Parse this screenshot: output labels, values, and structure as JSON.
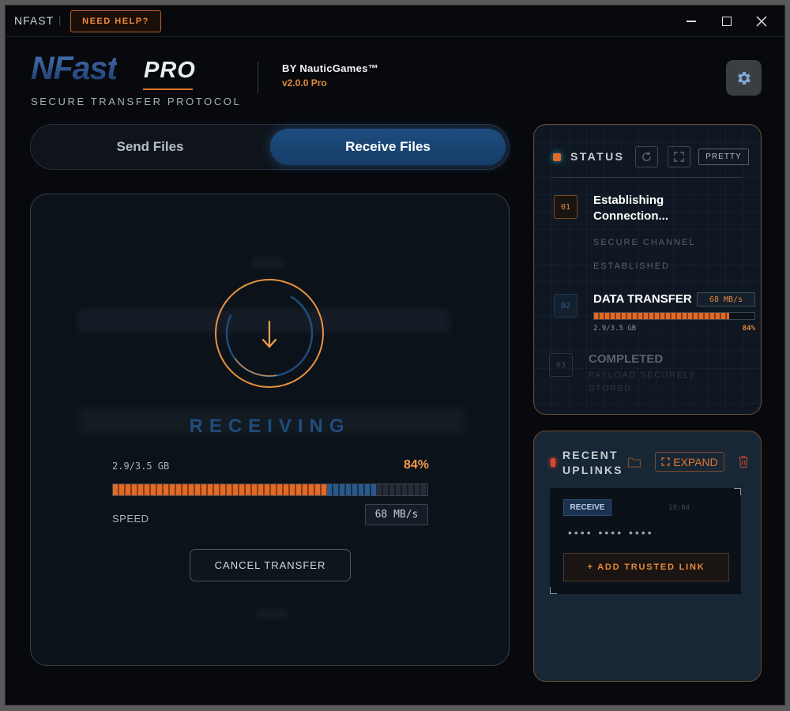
{
  "window": {
    "app_name": "NFAST",
    "separator": "|",
    "help_button": "NEED HELP?"
  },
  "header": {
    "logo_main": "NFast",
    "logo_sub": "PRO",
    "tagline": "SECURE TRANSFER PROTOCOL",
    "by_line": "BY NauticGames™",
    "version": "v2.0.0 Pro",
    "settings_icon": "gear-icon"
  },
  "tabs": [
    {
      "label": "Send Files",
      "active": false
    },
    {
      "label": "Receive Files",
      "active": true
    }
  ],
  "transfer": {
    "state": "RECEIVING",
    "size": "2.9/3.5 GB",
    "percent_label": "84%",
    "progress": 0.84,
    "speed_label": "SPEED",
    "speed_value": "68 MB/s",
    "cancel_button": "CANCEL TRANSFER"
  },
  "status": {
    "title": "STATUS",
    "pretty_button": "PRETTY",
    "steps": [
      {
        "num": "01",
        "title": "Establishing Connection...",
        "sub1": "SECURE CHANNEL",
        "sub2": "ESTABLISHED"
      },
      {
        "num": "02",
        "title": "DATA TRANSFER",
        "speed": "68 MB/s",
        "size": "2.9/3.5 GB",
        "percent": "84%",
        "progress": 0.84
      },
      {
        "num": "03",
        "title": "COMPLETED",
        "sub": "PAYLOAD SECURELY STORED"
      }
    ]
  },
  "uplinks": {
    "title": "RECENT UPLINKS",
    "expand_button": "EXPAND",
    "items": [
      {
        "badge": "RECEIVE",
        "time": "19:04",
        "masked": "•••• •••• ••••"
      }
    ],
    "add_button": "+ ADD TRUSTED LINK"
  },
  "colors": {
    "accent_orange": "#e06a28",
    "accent_blue": "#1f4c7c",
    "panel_border": "#6b4a30"
  }
}
